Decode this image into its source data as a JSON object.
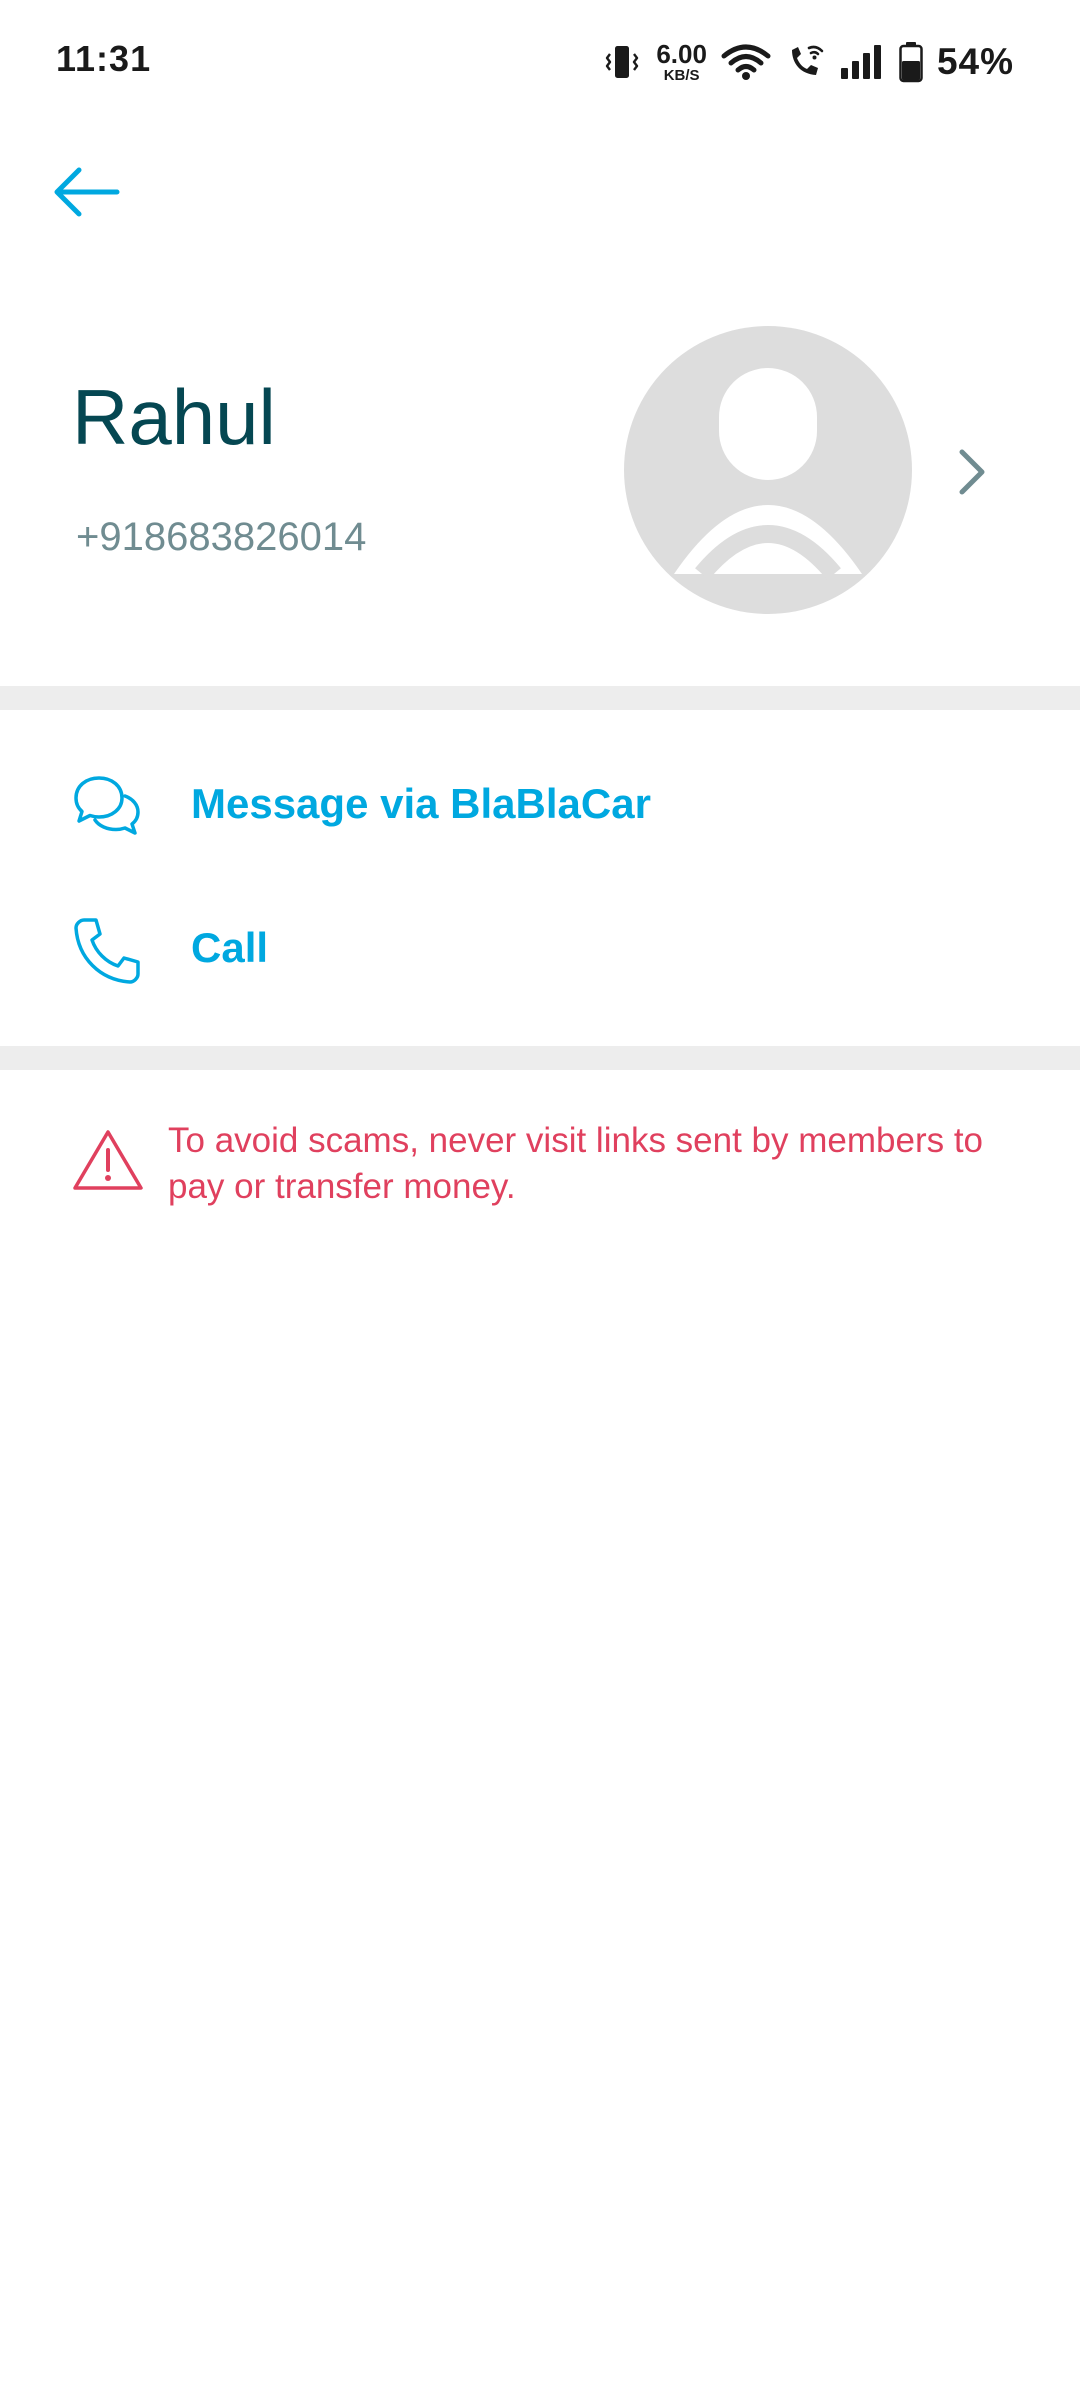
{
  "status_bar": {
    "time": "11:31",
    "net_speed_value": "6.00",
    "net_speed_unit": "KB/S",
    "battery_percent": "54%"
  },
  "header": {
    "back_icon": "arrow-left-icon"
  },
  "profile": {
    "name": "Rahul",
    "phone": "+918683826014",
    "avatar_icon": "user-avatar-placeholder"
  },
  "actions": [
    {
      "label": "Message via BlaBlaCar",
      "icon": "chat-bubbles-icon"
    },
    {
      "label": "Call",
      "icon": "phone-icon"
    }
  ],
  "warning": {
    "text": "To avoid scams, never visit links sent by members to pay or transfer money.",
    "icon": "warning-triangle-icon"
  },
  "colors": {
    "accent": "#00a8e0",
    "name": "#054752",
    "phone": "#708c91",
    "warning": "#e0405e",
    "divider": "#ededed"
  }
}
